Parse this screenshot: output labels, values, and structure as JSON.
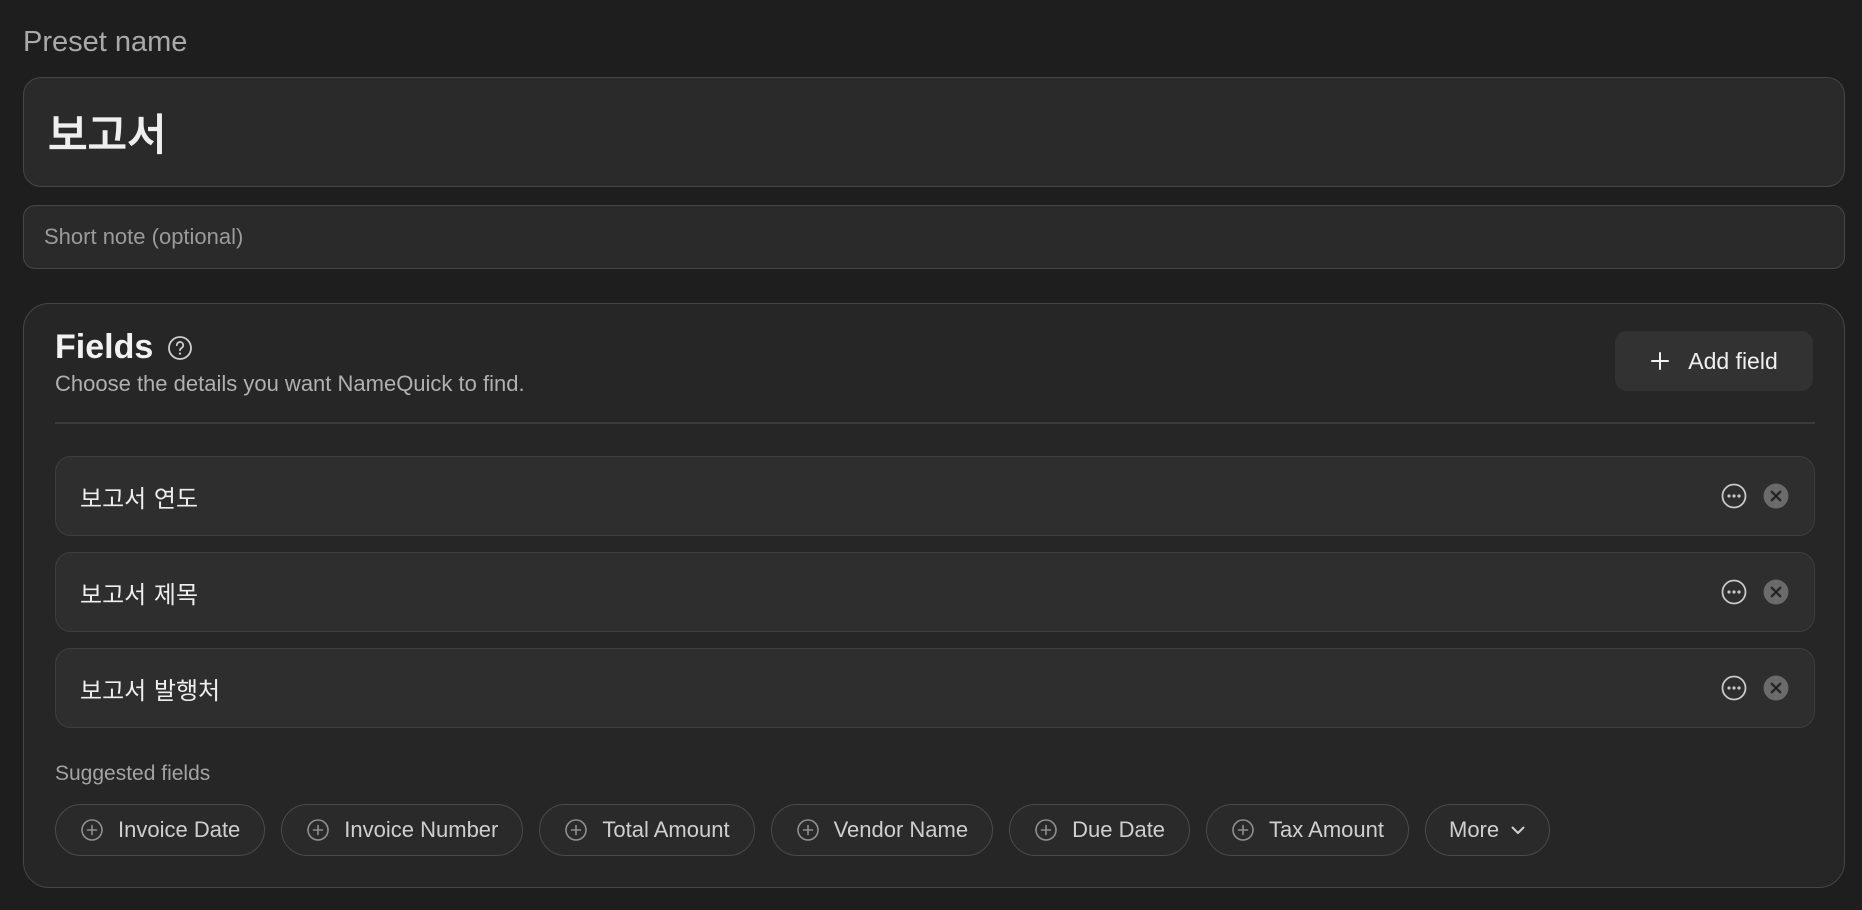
{
  "preset": {
    "label": "Preset name",
    "name": "보고서",
    "note_placeholder": "Short note (optional)",
    "note_value": ""
  },
  "fields": {
    "title": "Fields",
    "subtitle": "Choose the details you want NameQuick to find.",
    "add_button_label": "Add field",
    "items": [
      {
        "label": "보고서 연도"
      },
      {
        "label": "보고서 제목"
      },
      {
        "label": "보고서 발행처"
      }
    ]
  },
  "suggested": {
    "label": "Suggested fields",
    "chips": [
      {
        "label": "Invoice Date"
      },
      {
        "label": "Invoice Number"
      },
      {
        "label": "Total Amount"
      },
      {
        "label": "Vendor Name"
      },
      {
        "label": "Due Date"
      },
      {
        "label": "Tax Amount"
      }
    ],
    "more_label": "More"
  },
  "icons": {
    "help": "question-circle-icon",
    "add": "plus-icon",
    "row_more": "ellipsis-circle-icon",
    "row_remove": "x-circle-icon",
    "chip_add": "plus-circle-icon",
    "more_chevron": "chevron-down-icon"
  },
  "colors": {
    "background": "#1e1e1e",
    "panel": "#262626",
    "border": "#464646",
    "text_primary": "#ececec",
    "text_secondary": "#a9a9a9"
  }
}
